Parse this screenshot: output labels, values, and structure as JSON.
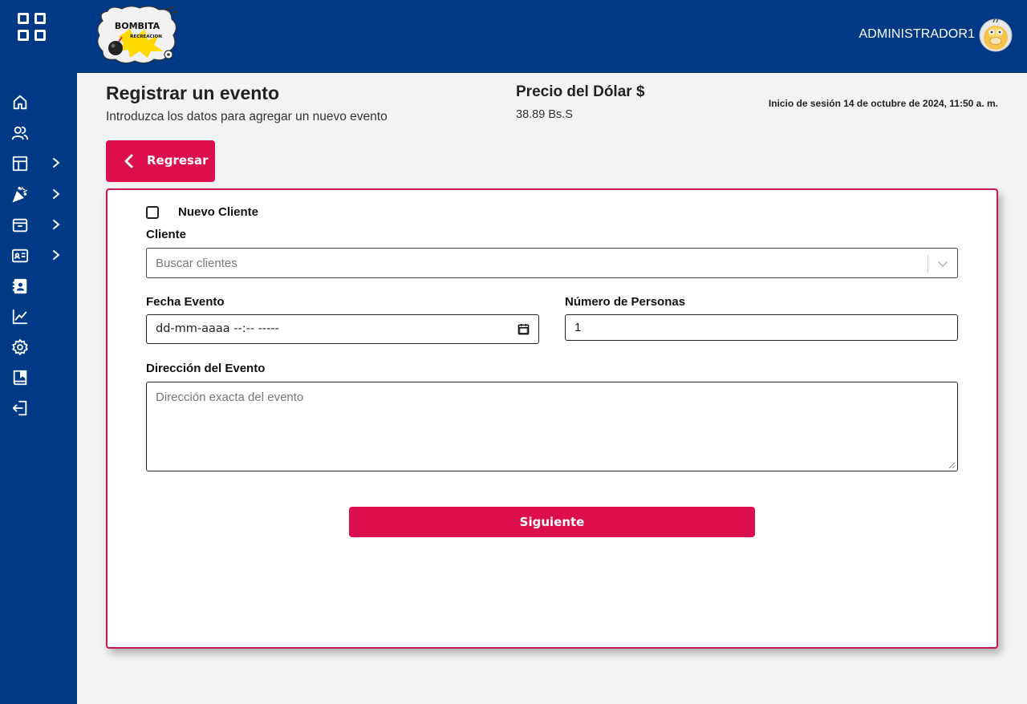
{
  "header": {
    "user_name": "ADMINISTRADOR1",
    "logo": {
      "line1": "BOMBITA",
      "line2": "RECREACION"
    },
    "colors": {
      "navy": "#003a87",
      "accent": "#dc0e4c"
    }
  },
  "sidebar": {
    "items": [
      {
        "icon": "home-icon",
        "expandable": false
      },
      {
        "icon": "users-icon",
        "expandable": false
      },
      {
        "icon": "layout-icon",
        "expandable": true
      },
      {
        "icon": "party-icon",
        "expandable": true
      },
      {
        "icon": "archive-icon",
        "expandable": true
      },
      {
        "icon": "id-card-icon",
        "expandable": true
      },
      {
        "icon": "contact-book-icon",
        "expandable": false
      },
      {
        "icon": "chart-line-icon",
        "expandable": false
      },
      {
        "icon": "gear-icon",
        "expandable": false
      },
      {
        "icon": "book-icon",
        "expandable": false
      },
      {
        "icon": "logout-icon",
        "expandable": false
      }
    ]
  },
  "page": {
    "title": "Registrar un evento",
    "subtitle": "Introduzca los datos para agregar un nuevo evento",
    "dollar_title": "Precio del Dólar $",
    "dollar_value": "38.89 Bs.S",
    "session": "Inicio de sesión 14 de octubre de 2024, 11:50 a. m.",
    "back_label": "Regresar"
  },
  "form": {
    "new_client_label": "Nuevo Cliente",
    "new_client_checked": false,
    "client_label": "Cliente",
    "client_placeholder": "Buscar clientes",
    "date_label": "Fecha Evento",
    "date_value": "dd-mm-aaaa --:--  -----",
    "people_label": "Número de Personas",
    "people_value": "1",
    "address_label": "Dirección del Evento",
    "address_placeholder": "Dirección exacta del evento",
    "next_label": "Siguiente"
  }
}
